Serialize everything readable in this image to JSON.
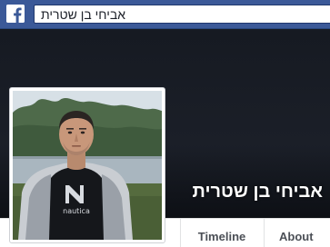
{
  "header": {
    "logo_icon": "facebook-f-icon",
    "brand_color": "#3b5998",
    "search_value": "אביחי בן שטרית"
  },
  "profile": {
    "name": "אביחי בן שטרית",
    "photo_print": "nautica"
  },
  "tabs": {
    "timeline": "Timeline",
    "about": "About"
  }
}
